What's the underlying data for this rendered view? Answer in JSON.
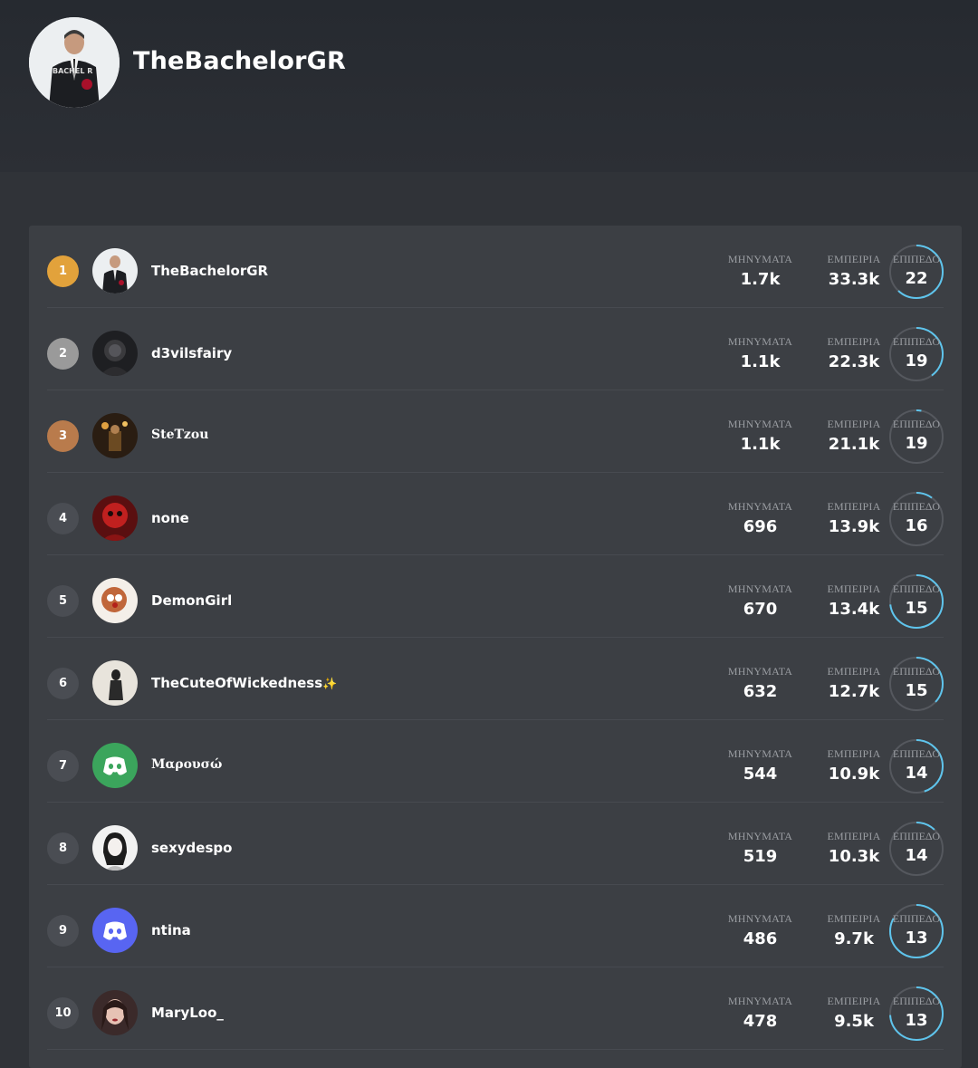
{
  "server": {
    "name": "TheBachelorGR",
    "avatar_icon": "server-avatar-bachelor-icon"
  },
  "labels": {
    "messages": "ΜΗΝΥΜΑΤΑ",
    "experience": "ΕΜΠΕΙΡΙΑ",
    "level": "ΕΠΙΠΕΔΟ"
  },
  "colors": {
    "gold": "#e2a23b",
    "silver": "#9a9a9a",
    "bronze": "#b97b4c",
    "default_rank": "#4a4d53",
    "ring": "#5ec4ec"
  },
  "leaderboard": [
    {
      "rank": "1",
      "name": "TheBachelorGR",
      "messages": "1.7k",
      "experience": "33.3k",
      "level": "22",
      "level_progress": 0.62,
      "avatar_icon": "bachelor-avatar-icon"
    },
    {
      "rank": "2",
      "name": "d3vilsfairy",
      "messages": "1.1k",
      "experience": "22.3k",
      "level": "19",
      "level_progress": 0.4,
      "avatar_icon": "dark-photo-avatar-icon"
    },
    {
      "rank": "3",
      "name": "SteTzou",
      "messages": "1.1k",
      "experience": "21.1k",
      "level": "19",
      "level_progress": 0.03,
      "avatar_icon": "night-photo-avatar-icon"
    },
    {
      "rank": "4",
      "name": "none",
      "messages": "696",
      "experience": "13.9k",
      "level": "16",
      "level_progress": 0.1,
      "avatar_icon": "red-art-avatar-icon"
    },
    {
      "rank": "5",
      "name": "DemonGirl",
      "messages": "670",
      "experience": "13.4k",
      "level": "15",
      "level_progress": 0.73,
      "avatar_icon": "clown-art-avatar-icon"
    },
    {
      "rank": "6",
      "name": "TheCuteOfWickedness",
      "name_suffix": "✨",
      "messages": "632",
      "experience": "12.7k",
      "level": "15",
      "level_progress": 0.37,
      "avatar_icon": "figure-sketch-avatar-icon"
    },
    {
      "rank": "7",
      "name": "Μαρουσώ",
      "messages": "544",
      "experience": "10.9k",
      "level": "14",
      "level_progress": 0.45,
      "avatar_icon": "discord-default-avatar-icon",
      "avatar_color": "#3ba55c"
    },
    {
      "rank": "8",
      "name": "sexydespo",
      "messages": "519",
      "experience": "10.3k",
      "level": "14",
      "level_progress": 0.12,
      "avatar_icon": "anime-sketch-avatar-icon"
    },
    {
      "rank": "9",
      "name": "ntina",
      "messages": "486",
      "experience": "9.7k",
      "level": "13",
      "level_progress": 0.83,
      "avatar_icon": "discord-default-avatar-icon",
      "avatar_color": "#5865f2"
    },
    {
      "rank": "10",
      "name": "MaryLoo_",
      "messages": "478",
      "experience": "9.5k",
      "level": "13",
      "level_progress": 0.74,
      "avatar_icon": "portrait-photo-avatar-icon"
    }
  ]
}
